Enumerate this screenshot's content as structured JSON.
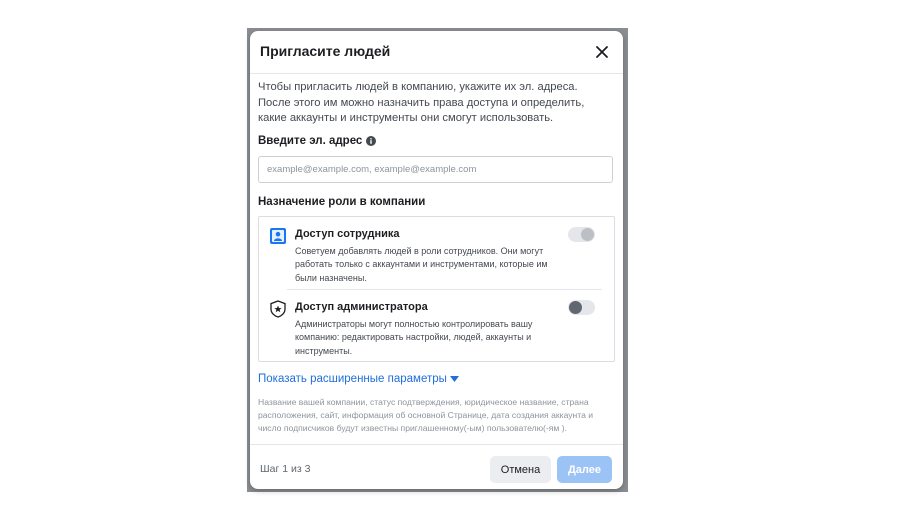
{
  "dialog": {
    "title": "Пригласите людей",
    "description": "Чтобы пригласить людей в компанию, укажите их эл. адреса. После этого им можно назначить права доступа и определить, какие аккаунты и инструменты они смогут использовать.",
    "email_label": "Введите эл. адрес",
    "email_placeholder": "example@example.com, example@example.com",
    "email_value": "",
    "roles_label": "Назначение роли в компании",
    "roles": [
      {
        "title": "Доступ сотрудника",
        "description": "Советуем добавлять людей в роли сотрудников. Они могут работать только с аккаунтами и инструментами, которые им были назначены.",
        "icon": "employee-badge-icon",
        "enabled": true
      },
      {
        "title": "Доступ администратора",
        "description": "Администраторы могут полностью контролировать вашу компанию: редактировать настройки, людей, аккаунты и инструменты.",
        "icon": "admin-shield-icon",
        "enabled": false
      }
    ],
    "advanced_link": "Показать расширенные параметры",
    "note": "Название вашей компании, статус подтверждения, юридическое название, страна расположения, сайт, информация об основной Странице, дата создания аккаунта и число подписчиков будут известны приглашенному(-ым) пользователю(-ям ).",
    "step": "Шаг 1 из 3",
    "cancel_label": "Отмена",
    "next_label": "Далее"
  },
  "colors": {
    "accent": "#216fdb",
    "primary_disabled": "#9cc3f5",
    "text": "#1c1e21",
    "muted": "#8d949e"
  }
}
